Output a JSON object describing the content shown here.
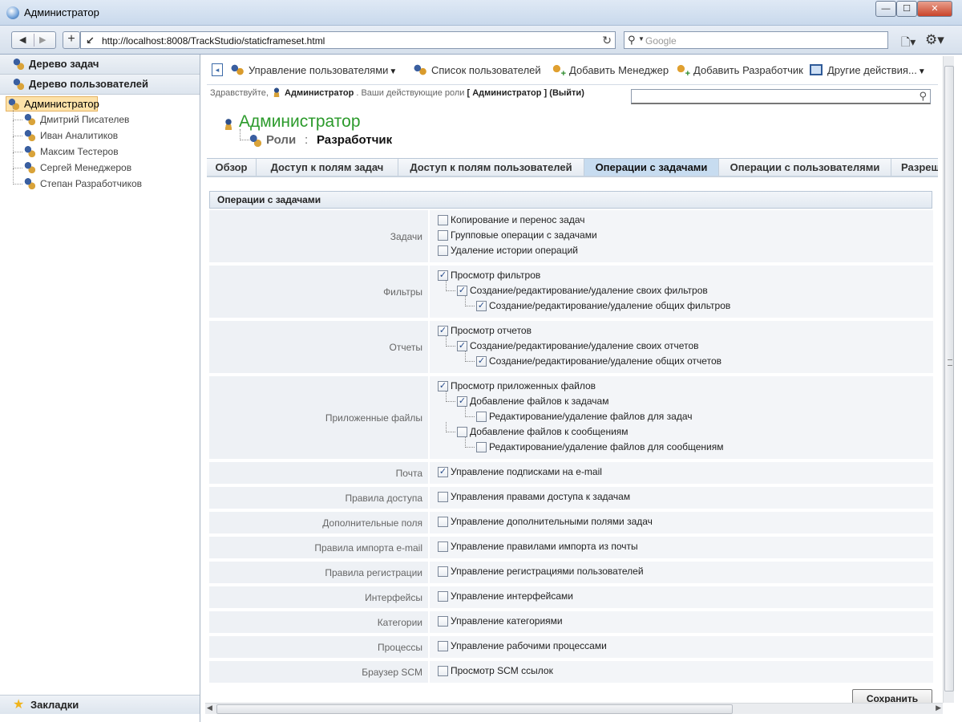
{
  "window": {
    "title": "Администратор"
  },
  "browser": {
    "url": "http://localhost:8008/TrackStudio/staticframeset.html",
    "search_placeholder": "Google"
  },
  "left": {
    "task_tree": "Дерево задач",
    "user_tree": "Дерево пользователей",
    "root": "Администратор",
    "users": [
      "Дмитрий Писателев",
      "Иван Аналитиков",
      "Максим Тестеров",
      "Сергей Менеджеров",
      "Степан Разработчиков"
    ],
    "bookmarks": "Закладки"
  },
  "toolbar": {
    "manage_users": "Управление пользователями",
    "user_list": "Список пользователей",
    "add_manager": "Добавить Менеджер",
    "add_developer": "Добавить Разработчик",
    "other_actions": "Другие действия..."
  },
  "greeting": {
    "hello": "Здравствуйте,",
    "user": "Администратор",
    "roles_text": ". Ваши действующие роли",
    "role": "[ Администратор ]",
    "logout": "(Выйти)"
  },
  "header": {
    "user": "Администратор",
    "role_label": "Роли",
    "role_sep": ":",
    "role_value": "Разработчик"
  },
  "tabs": [
    "Обзор",
    "Доступ к полям задач",
    "Доступ к полям пользователей",
    "Операции с задачами",
    "Операции с пользователями",
    "Разрешения"
  ],
  "active_tab": 3,
  "section_title": "Операции с задачами",
  "groups": [
    {
      "label": "Задачи",
      "options": [
        {
          "text": "Копирование и перенос задач",
          "checked": false,
          "level": 0
        },
        {
          "text": "Групповые операции с задачами",
          "checked": false,
          "level": 0
        },
        {
          "text": "Удаление истории операций",
          "checked": false,
          "level": 0
        }
      ]
    },
    {
      "label": "Фильтры",
      "options": [
        {
          "text": "Просмотр фильтров",
          "checked": true,
          "level": 0
        },
        {
          "text": "Создание/редактирование/удаление своих фильтров",
          "checked": true,
          "level": 1
        },
        {
          "text": "Создание/редактирование/удаление общих фильтров",
          "checked": true,
          "level": 2
        }
      ]
    },
    {
      "label": "Отчеты",
      "options": [
        {
          "text": "Просмотр отчетов",
          "checked": true,
          "level": 0
        },
        {
          "text": "Создание/редактирование/удаление своих отчетов",
          "checked": true,
          "level": 1
        },
        {
          "text": "Создание/редактирование/удаление общих отчетов",
          "checked": true,
          "level": 2
        }
      ]
    },
    {
      "label": "Приложенные файлы",
      "options": [
        {
          "text": "Просмотр приложенных файлов",
          "checked": true,
          "level": 0
        },
        {
          "text": "Добавление файлов к задачам",
          "checked": true,
          "level": 1
        },
        {
          "text": "Редактирование/удаление файлов для задач",
          "checked": false,
          "level": 2
        },
        {
          "text": "Добавление файлов к сообщениям",
          "checked": false,
          "level": 1
        },
        {
          "text": "Редактирование/удаление файлов для сообщениям",
          "checked": false,
          "level": 2
        }
      ]
    },
    {
      "label": "Почта",
      "options": [
        {
          "text": "Управление подписками на e-mail",
          "checked": true,
          "level": 0
        }
      ]
    },
    {
      "label": "Правила доступа",
      "options": [
        {
          "text": "Управления правами доступа к задачам",
          "checked": false,
          "level": 0
        }
      ]
    },
    {
      "label": "Дополнительные поля",
      "options": [
        {
          "text": "Управление дополнительными полями задач",
          "checked": false,
          "level": 0
        }
      ]
    },
    {
      "label": "Правила импорта e-mail",
      "options": [
        {
          "text": "Управление правилами импорта из почты",
          "checked": false,
          "level": 0
        }
      ]
    },
    {
      "label": "Правила регистрации",
      "options": [
        {
          "text": "Управление регистрациями пользователей",
          "checked": false,
          "level": 0
        }
      ]
    },
    {
      "label": "Интерфейсы",
      "options": [
        {
          "text": "Управление интерфейсами",
          "checked": false,
          "level": 0
        }
      ]
    },
    {
      "label": "Категории",
      "options": [
        {
          "text": "Управление категориями",
          "checked": false,
          "level": 0
        }
      ]
    },
    {
      "label": "Процессы",
      "options": [
        {
          "text": "Управление рабочими процессами",
          "checked": false,
          "level": 0
        }
      ]
    },
    {
      "label": "Браузер SCM",
      "options": [
        {
          "text": "Просмотр SCM ссылок",
          "checked": false,
          "level": 0
        }
      ]
    }
  ],
  "save_label": "Сохранить"
}
